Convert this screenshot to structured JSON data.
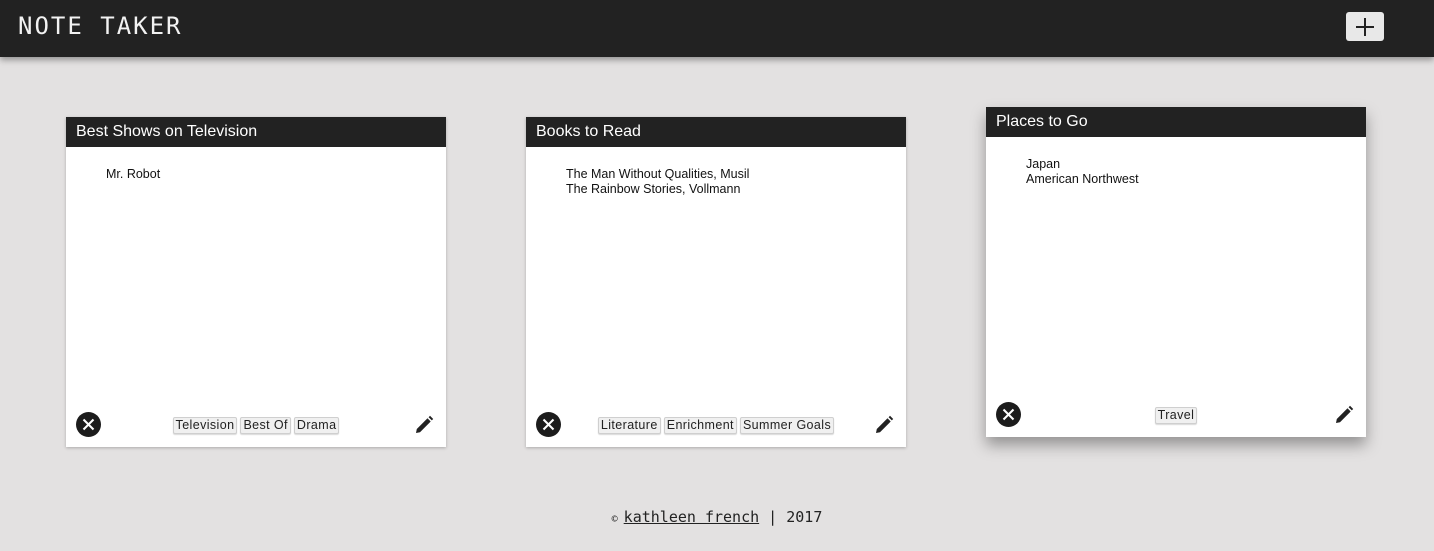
{
  "header": {
    "title": "NOTE TAKER",
    "add_icon": "plus-icon"
  },
  "notes": [
    {
      "title": "Best Shows on Television",
      "lines": [
        "Mr. Robot"
      ],
      "tags": [
        "Television",
        "Best Of",
        "Drama"
      ]
    },
    {
      "title": "Books to Read",
      "lines": [
        "The Man Without Qualities, Musil",
        "The Rainbow Stories, Vollmann"
      ],
      "tags": [
        "Literature",
        "Enrichment",
        "Summer Goals"
      ]
    },
    {
      "title": "Places to Go",
      "lines": [
        "Japan",
        "American Northwest"
      ],
      "tags": [
        "Travel"
      ]
    }
  ],
  "footer": {
    "copyright_symbol": "©",
    "author": "kathleen french",
    "separator": "|",
    "year": "2017"
  },
  "colors": {
    "bar": "#222222",
    "background": "#e3e1e1",
    "card": "#ffffff"
  }
}
